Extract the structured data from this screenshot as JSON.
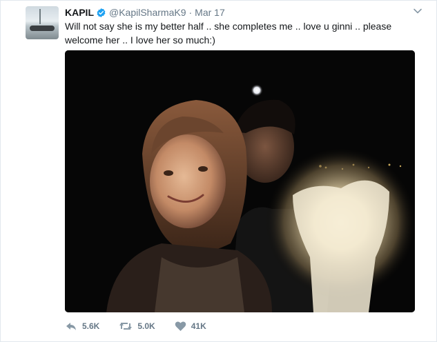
{
  "tweet": {
    "name": "KAPIL",
    "handle": "@KapilSharmaK9",
    "separator": "·",
    "date": "Mar 17",
    "text": "Will not say she is my better half .. she completes me .. love u ginni .. please welcome her .. I love her so much:)"
  },
  "actions": {
    "reply": {
      "icon": "reply-icon",
      "count": "5.6K"
    },
    "retweet": {
      "icon": "retweet-icon",
      "count": "5.0K"
    },
    "like": {
      "icon": "heart-icon",
      "count": "41K"
    }
  },
  "colors": {
    "text": "#14171a",
    "muted": "#657786",
    "verified": "#1da1f2",
    "border": "#e1e8ed"
  }
}
